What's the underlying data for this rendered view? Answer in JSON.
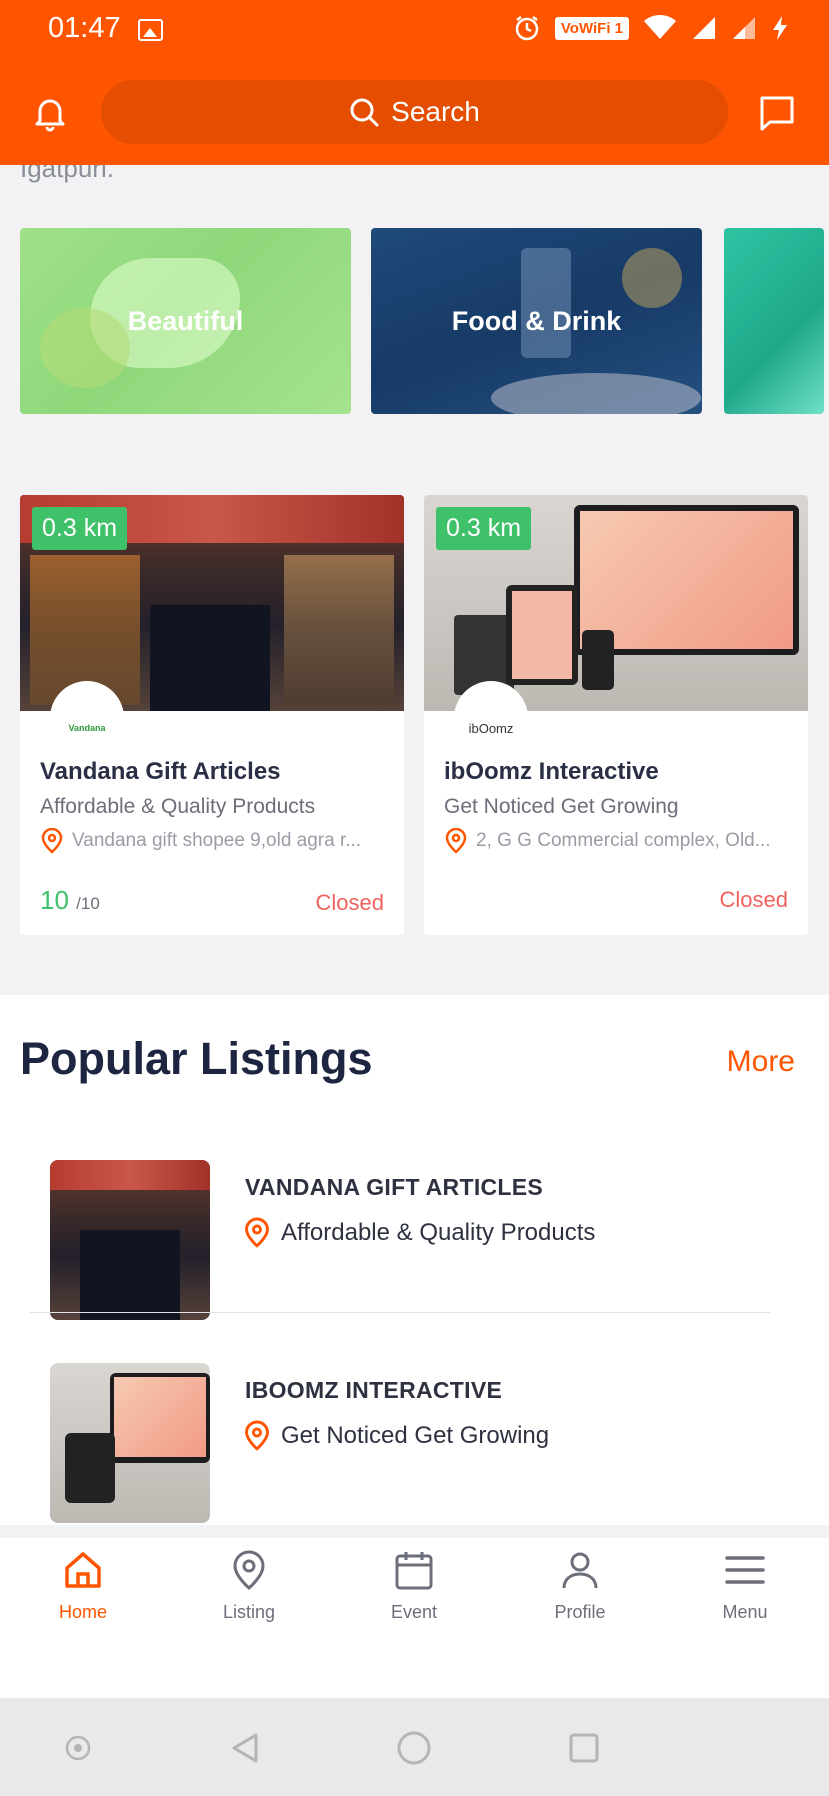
{
  "status_bar": {
    "time": "01:47",
    "network_label": "VoWiFi 1"
  },
  "header": {
    "search_placeholder": "Search",
    "icons": [
      "bell-icon",
      "search-icon",
      "chat-icon"
    ]
  },
  "content": {
    "partial_text": "Igatpuri.",
    "categories": [
      {
        "label": "Beautiful"
      },
      {
        "label": "Food & Drink"
      },
      {
        "label": ""
      }
    ],
    "listings": [
      {
        "distance": "0.3 km",
        "logo_text": "Vandana",
        "title": "Vandana Gift Articles",
        "subtitle": "Affordable & Quality Products",
        "address": "Vandana gift shopee 9,old agra r...",
        "rating": "10",
        "rating_max": "/10",
        "status": "Closed"
      },
      {
        "distance": "0.3 km",
        "logo_text": "ibOomz",
        "title": "ibOomz Interactive",
        "subtitle": "Get Noticed Get Growing",
        "address": "2, G G Commercial complex, Old...",
        "status": "Closed"
      }
    ]
  },
  "popular": {
    "title": "Popular Listings",
    "more_label": "More",
    "items": [
      {
        "name": "VANDANA GIFT ARTICLES",
        "desc": "Affordable & Quality Products"
      },
      {
        "name": "IBOOMZ INTERACTIVE",
        "desc": "Get Noticed Get Growing"
      }
    ]
  },
  "bottom_nav": {
    "items": [
      {
        "label": "Home",
        "icon": "home-icon",
        "active": true
      },
      {
        "label": "Listing",
        "icon": "location-pin-icon",
        "active": false
      },
      {
        "label": "Event",
        "icon": "calendar-icon",
        "active": false
      },
      {
        "label": "Profile",
        "icon": "user-icon",
        "active": false
      },
      {
        "label": "Menu",
        "icon": "hamburger-icon",
        "active": false
      }
    ]
  },
  "colors": {
    "accent": "#ff5500",
    "green": "#3ec169",
    "closed_red": "#f0625e",
    "dark_text": "#1e2541"
  }
}
